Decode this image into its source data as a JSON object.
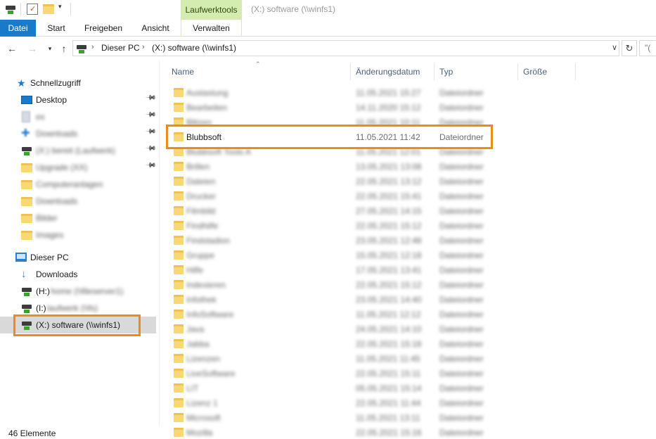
{
  "window": {
    "contextual_tab": "Laufwerktools",
    "title": "(X:) software (\\\\winfs1)"
  },
  "ribbon": {
    "tabs": [
      {
        "label": "Datei"
      },
      {
        "label": "Start"
      },
      {
        "label": "Freigeben"
      },
      {
        "label": "Ansicht"
      },
      {
        "label": "Verwalten"
      }
    ]
  },
  "address": {
    "crumbs": [
      "Dieser PC",
      "(X:) software (\\\\winfs1)"
    ],
    "search_placeholder": "\"("
  },
  "nav": {
    "quick_access": "Schnellzugriff",
    "quick_items": [
      {
        "label": "Desktop",
        "blurred": false,
        "icon": "desktop-icon"
      },
      {
        "label": "ex",
        "blurred": true,
        "icon": "document-icon"
      },
      {
        "label": "Downloads",
        "blurred": true,
        "icon": "download-icon"
      },
      {
        "label": "(X:) bereit (Laufwerk)",
        "blurred": true,
        "icon": "drive-icon"
      },
      {
        "label": "Upgrade (XX)",
        "blurred": true,
        "icon": "folder-icon"
      },
      {
        "label": "Computeranlagen",
        "blurred": true,
        "icon": "folder-icon"
      },
      {
        "label": "Downloads",
        "blurred": true,
        "icon": "folder-icon"
      },
      {
        "label": "Bilder",
        "blurred": true,
        "icon": "folder-icon"
      },
      {
        "label": "Images",
        "blurred": true,
        "icon": "folder-icon"
      }
    ],
    "this_pc": "Dieser PC",
    "downloads": "Downloads",
    "drive_h": "(H:)",
    "drive_h_blur": "home (\\\\fileserver1)",
    "drive_i": "(I:)",
    "drive_i_blur": "laufwerk (\\\\fs)",
    "drive_x": "(X:) software (\\\\winfs1)"
  },
  "columns": {
    "name": "Name",
    "date": "Änderungsdatum",
    "type": "Typ",
    "size": "Größe"
  },
  "files": [
    {
      "name": "Auslastung",
      "date": "11.05.2021 15:27",
      "type": "Dateiordner",
      "blurred": true
    },
    {
      "name": "Bearbeiten",
      "date": "14.11.2020 15:12",
      "type": "Dateiordner",
      "blurred": true
    },
    {
      "name": "Blitzen",
      "date": "11.05.2021 10:11",
      "type": "Dateiordner",
      "blurred": true
    },
    {
      "name": "Blubbsoft",
      "date": "11.05.2021 11:42",
      "type": "Dateiordner",
      "blurred": false
    },
    {
      "name": "Blubbsoft Tools A",
      "date": "11.05.2021 12:01",
      "type": "Dateiordner",
      "blurred": true
    },
    {
      "name": "Brillen",
      "date": "13.05.2021 13:08",
      "type": "Dateiordner",
      "blurred": true
    },
    {
      "name": "Dateien",
      "date": "22.05.2021 13:12",
      "type": "Dateiordner",
      "blurred": true
    },
    {
      "name": "Drucker",
      "date": "22.05.2021 15:41",
      "type": "Dateiordner",
      "blurred": true
    },
    {
      "name": "Filmbild",
      "date": "27.05.2021 14:15",
      "type": "Dateiordner",
      "blurred": true
    },
    {
      "name": "Findhilfe",
      "date": "22.05.2021 15:12",
      "type": "Dateiordner",
      "blurred": true
    },
    {
      "name": "Findstadion",
      "date": "23.05.2021 12:48",
      "type": "Dateiordner",
      "blurred": true
    },
    {
      "name": "Gruppe",
      "date": "15.05.2021 12:18",
      "type": "Dateiordner",
      "blurred": true
    },
    {
      "name": "Hilfe",
      "date": "17.05.2021 13:41",
      "type": "Dateiordner",
      "blurred": true
    },
    {
      "name": "Indexieren",
      "date": "22.05.2021 15:12",
      "type": "Dateiordner",
      "blurred": true
    },
    {
      "name": "Infothek",
      "date": "23.05.2021 14:40",
      "type": "Dateiordner",
      "blurred": true
    },
    {
      "name": "InfoSoftware",
      "date": "11.05.2021 12:12",
      "type": "Dateiordner",
      "blurred": true
    },
    {
      "name": "Java",
      "date": "24.05.2021 14:10",
      "type": "Dateiordner",
      "blurred": true
    },
    {
      "name": "Jabba",
      "date": "22.05.2021 15:18",
      "type": "Dateiordner",
      "blurred": true
    },
    {
      "name": "Lizenzen",
      "date": "11.05.2021 11:45",
      "type": "Dateiordner",
      "blurred": true
    },
    {
      "name": "LiveSoftware",
      "date": "22.05.2021 15:11",
      "type": "Dateiordner",
      "blurred": true
    },
    {
      "name": "LIT",
      "date": "05.05.2021 15:14",
      "type": "Dateiordner",
      "blurred": true
    },
    {
      "name": "Lizenz 1",
      "date": "22.05.2021 11:44",
      "type": "Dateiordner",
      "blurred": true
    },
    {
      "name": "Microsoft",
      "date": "11.05.2021 13:11",
      "type": "Dateiordner",
      "blurred": true
    },
    {
      "name": "Mozilla",
      "date": "22.05.2021 15:16",
      "type": "Dateiordner",
      "blurred": true
    }
  ],
  "status": {
    "count": "46 Elemente"
  },
  "colors": {
    "accent": "#1979ca",
    "tool_tab": "#d5ecb1",
    "highlight": "#ee8a1c"
  }
}
